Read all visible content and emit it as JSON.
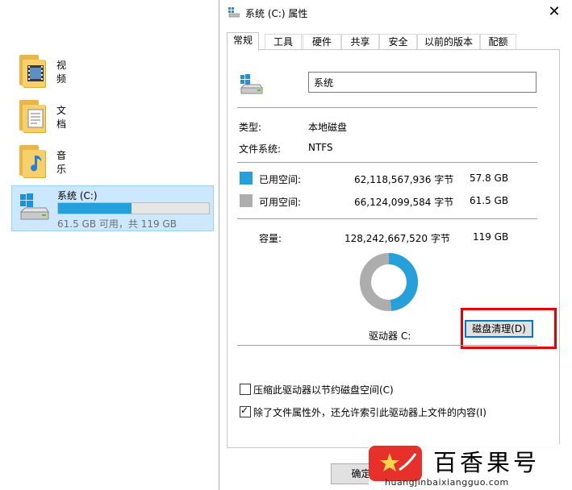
{
  "explorer": {
    "folders": [
      {
        "label": "视频",
        "icon": "video-folder-icon"
      },
      {
        "label": "文档",
        "icon": "documents-folder-icon"
      },
      {
        "label": "音乐",
        "icon": "music-folder-icon"
      }
    ],
    "drive": {
      "name": "系统 (C:)",
      "usage_fraction": 0.484,
      "info": "61.5 GB 可用，共 119 GB"
    }
  },
  "dialog": {
    "title": "系统 (C:) 属性",
    "close_label": "✕",
    "tabs": [
      "常规",
      "工具",
      "硬件",
      "共享",
      "安全",
      "以前的版本",
      "配额"
    ],
    "active_tab": "常规",
    "volume_name": "系统",
    "type_label": "类型:",
    "type_value": "本地磁盘",
    "fs_label": "文件系统:",
    "fs_value": "NTFS",
    "used": {
      "label": "已用空间:",
      "bytes": "62,118,567,936 字节",
      "size": "57.8 GB",
      "color": "#26a0da"
    },
    "free": {
      "label": "可用空间:",
      "bytes": "66,124,099,584 字节",
      "size": "61.5 GB",
      "color": "#adadad"
    },
    "capacity": {
      "label": "容量:",
      "bytes": "128,242,667,520 字节",
      "size": "119 GB"
    },
    "used_fraction": 0.484,
    "drive_label": "驱动器 C:",
    "cleanup_button": "磁盘清理(D)",
    "compress_option": {
      "label": "压缩此驱动器以节约磁盘空间(C)",
      "checked": false
    },
    "index_option": {
      "label": "除了文件属性外，还允许索引此驱动器上文件的内容(I)",
      "checked": true
    },
    "ok_button": "确定"
  },
  "watermark": {
    "text": "百香果号",
    "url": "huangjinbaixiangguo.com"
  }
}
